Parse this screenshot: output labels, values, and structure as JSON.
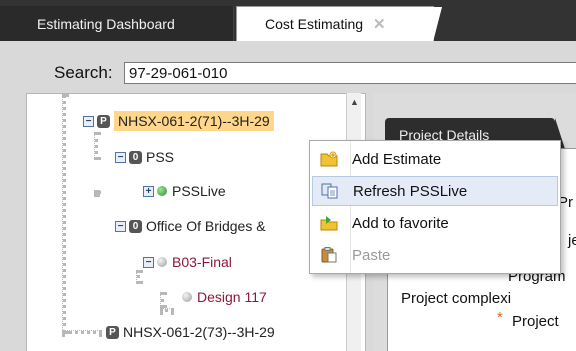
{
  "tabs": {
    "dashboard": "Estimating Dashboard",
    "cost": "Cost Estimating",
    "close_glyph": "✕"
  },
  "search": {
    "label": "Search:",
    "value": "97-29-061-010"
  },
  "tree": {
    "nodes": [
      {
        "expander": "−",
        "badge": "P",
        "label": "NHSX-061-2(71)--3H-29"
      },
      {
        "expander": "−",
        "badge": "0",
        "label": "PSS"
      },
      {
        "expander": "+",
        "label": "PSSLive"
      },
      {
        "expander": "−",
        "badge": "0",
        "label": "Office Of Bridges &"
      },
      {
        "expander": "−",
        "label": "B03-Final"
      },
      {
        "label": "Design 117"
      },
      {
        "badge": "P",
        "label": "NHSX-061-2(73)--3H-29"
      }
    ],
    "scroll_up": "▲"
  },
  "details": {
    "tab": "Project Details",
    "lines": [
      "Pr",
      "je",
      "Program",
      "Project complexi",
      "Project"
    ],
    "required": "*"
  },
  "context_menu": {
    "items": [
      {
        "label": "Add Estimate",
        "icon": "folder-add-icon",
        "state": "normal"
      },
      {
        "label": "Refresh PSSLive",
        "icon": "refresh-copy-icon",
        "state": "selected"
      },
      {
        "label": "Add to favorite",
        "icon": "favorite-add-icon",
        "state": "normal"
      },
      {
        "label": "Paste",
        "icon": "paste-icon",
        "state": "disabled"
      }
    ]
  },
  "colors": {
    "highlight": "#ffd68a",
    "menu_selected": "#e4ebf6",
    "node_red": "#8b1a3a",
    "status_green": "#2e8b2e"
  }
}
